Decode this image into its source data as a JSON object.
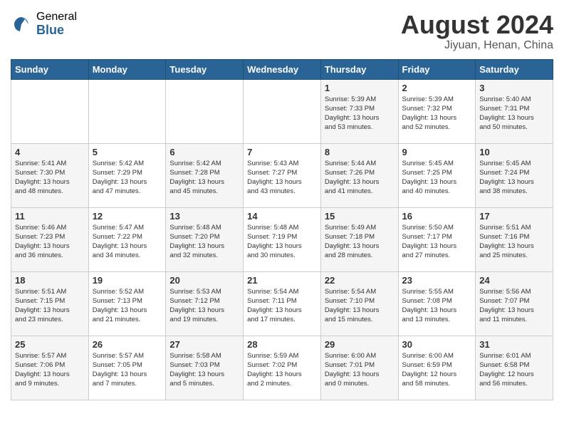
{
  "logo": {
    "general": "General",
    "blue": "Blue"
  },
  "title": {
    "month_year": "August 2024",
    "location": "Jiyuan, Henan, China"
  },
  "days_of_week": [
    "Sunday",
    "Monday",
    "Tuesday",
    "Wednesday",
    "Thursday",
    "Friday",
    "Saturday"
  ],
  "weeks": [
    [
      {
        "day": "",
        "detail": ""
      },
      {
        "day": "",
        "detail": ""
      },
      {
        "day": "",
        "detail": ""
      },
      {
        "day": "",
        "detail": ""
      },
      {
        "day": "1",
        "detail": "Sunrise: 5:39 AM\nSunset: 7:33 PM\nDaylight: 13 hours\nand 53 minutes."
      },
      {
        "day": "2",
        "detail": "Sunrise: 5:39 AM\nSunset: 7:32 PM\nDaylight: 13 hours\nand 52 minutes."
      },
      {
        "day": "3",
        "detail": "Sunrise: 5:40 AM\nSunset: 7:31 PM\nDaylight: 13 hours\nand 50 minutes."
      }
    ],
    [
      {
        "day": "4",
        "detail": "Sunrise: 5:41 AM\nSunset: 7:30 PM\nDaylight: 13 hours\nand 48 minutes."
      },
      {
        "day": "5",
        "detail": "Sunrise: 5:42 AM\nSunset: 7:29 PM\nDaylight: 13 hours\nand 47 minutes."
      },
      {
        "day": "6",
        "detail": "Sunrise: 5:42 AM\nSunset: 7:28 PM\nDaylight: 13 hours\nand 45 minutes."
      },
      {
        "day": "7",
        "detail": "Sunrise: 5:43 AM\nSunset: 7:27 PM\nDaylight: 13 hours\nand 43 minutes."
      },
      {
        "day": "8",
        "detail": "Sunrise: 5:44 AM\nSunset: 7:26 PM\nDaylight: 13 hours\nand 41 minutes."
      },
      {
        "day": "9",
        "detail": "Sunrise: 5:45 AM\nSunset: 7:25 PM\nDaylight: 13 hours\nand 40 minutes."
      },
      {
        "day": "10",
        "detail": "Sunrise: 5:45 AM\nSunset: 7:24 PM\nDaylight: 13 hours\nand 38 minutes."
      }
    ],
    [
      {
        "day": "11",
        "detail": "Sunrise: 5:46 AM\nSunset: 7:23 PM\nDaylight: 13 hours\nand 36 minutes."
      },
      {
        "day": "12",
        "detail": "Sunrise: 5:47 AM\nSunset: 7:22 PM\nDaylight: 13 hours\nand 34 minutes."
      },
      {
        "day": "13",
        "detail": "Sunrise: 5:48 AM\nSunset: 7:20 PM\nDaylight: 13 hours\nand 32 minutes."
      },
      {
        "day": "14",
        "detail": "Sunrise: 5:48 AM\nSunset: 7:19 PM\nDaylight: 13 hours\nand 30 minutes."
      },
      {
        "day": "15",
        "detail": "Sunrise: 5:49 AM\nSunset: 7:18 PM\nDaylight: 13 hours\nand 28 minutes."
      },
      {
        "day": "16",
        "detail": "Sunrise: 5:50 AM\nSunset: 7:17 PM\nDaylight: 13 hours\nand 27 minutes."
      },
      {
        "day": "17",
        "detail": "Sunrise: 5:51 AM\nSunset: 7:16 PM\nDaylight: 13 hours\nand 25 minutes."
      }
    ],
    [
      {
        "day": "18",
        "detail": "Sunrise: 5:51 AM\nSunset: 7:15 PM\nDaylight: 13 hours\nand 23 minutes."
      },
      {
        "day": "19",
        "detail": "Sunrise: 5:52 AM\nSunset: 7:13 PM\nDaylight: 13 hours\nand 21 minutes."
      },
      {
        "day": "20",
        "detail": "Sunrise: 5:53 AM\nSunset: 7:12 PM\nDaylight: 13 hours\nand 19 minutes."
      },
      {
        "day": "21",
        "detail": "Sunrise: 5:54 AM\nSunset: 7:11 PM\nDaylight: 13 hours\nand 17 minutes."
      },
      {
        "day": "22",
        "detail": "Sunrise: 5:54 AM\nSunset: 7:10 PM\nDaylight: 13 hours\nand 15 minutes."
      },
      {
        "day": "23",
        "detail": "Sunrise: 5:55 AM\nSunset: 7:08 PM\nDaylight: 13 hours\nand 13 minutes."
      },
      {
        "day": "24",
        "detail": "Sunrise: 5:56 AM\nSunset: 7:07 PM\nDaylight: 13 hours\nand 11 minutes."
      }
    ],
    [
      {
        "day": "25",
        "detail": "Sunrise: 5:57 AM\nSunset: 7:06 PM\nDaylight: 13 hours\nand 9 minutes."
      },
      {
        "day": "26",
        "detail": "Sunrise: 5:57 AM\nSunset: 7:05 PM\nDaylight: 13 hours\nand 7 minutes."
      },
      {
        "day": "27",
        "detail": "Sunrise: 5:58 AM\nSunset: 7:03 PM\nDaylight: 13 hours\nand 5 minutes."
      },
      {
        "day": "28",
        "detail": "Sunrise: 5:59 AM\nSunset: 7:02 PM\nDaylight: 13 hours\nand 2 minutes."
      },
      {
        "day": "29",
        "detail": "Sunrise: 6:00 AM\nSunset: 7:01 PM\nDaylight: 13 hours\nand 0 minutes."
      },
      {
        "day": "30",
        "detail": "Sunrise: 6:00 AM\nSunset: 6:59 PM\nDaylight: 12 hours\nand 58 minutes."
      },
      {
        "day": "31",
        "detail": "Sunrise: 6:01 AM\nSunset: 6:58 PM\nDaylight: 12 hours\nand 56 minutes."
      }
    ]
  ]
}
